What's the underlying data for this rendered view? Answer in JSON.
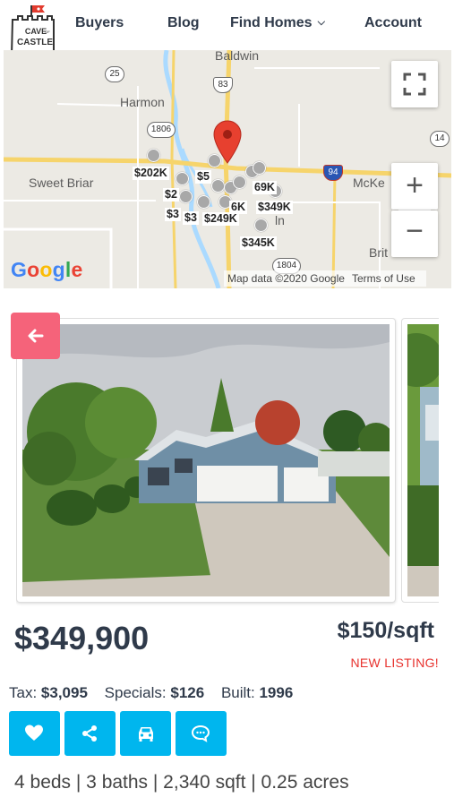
{
  "brand": {
    "logo_text_1": "CAVE",
    "logo_text_2": "OF",
    "logo_text_3": "CASTLE"
  },
  "nav": {
    "buyers": "Buyers",
    "blog": "Blog",
    "find_homes": "Find Homes",
    "account": "Account"
  },
  "map": {
    "places": {
      "baldwin": "Baldwin",
      "harmon": "Harmon",
      "sweet_briar": "Sweet Briar",
      "mckenzie": "McKe",
      "lincoln": "ln",
      "brit": "Brit"
    },
    "route_shields": {
      "r25": "25",
      "r83": "83",
      "r1806": "1806",
      "r14": "14",
      "i94": "94",
      "r1804": "1804"
    },
    "price_pins": {
      "p202k": "$202K",
      "p5": "$5",
      "p69": "69K",
      "p2": "$2",
      "p349k": "$349K",
      "p3a": "$3",
      "p3b": "$3",
      "p249k": "$249K",
      "p6k": "6K",
      "p345k": "$345K"
    },
    "google": "Google",
    "map_data": "Map data ©2020 Google",
    "terms": "Terms of Use",
    "zoom_in": "+",
    "zoom_out": "−"
  },
  "listing": {
    "price": "$349,900",
    "price_per_sqft": "$150/sqft",
    "status": "NEW LISTING!",
    "tax_label": "Tax:",
    "tax_value": "$3,095",
    "specials_label": "Specials:",
    "specials_value": "$126",
    "built_label": "Built:",
    "built_value": "1996",
    "specs": "4 beds | 3 baths | 2,340 sqft | 0.25 acres"
  },
  "actions": [
    "heart-icon",
    "share-icon",
    "car-icon",
    "chat-icon"
  ],
  "colors": {
    "accent": "#00b6ee",
    "back_button": "#f5637a",
    "new_listing": "#e8322e",
    "text": "#2f3a4a"
  }
}
